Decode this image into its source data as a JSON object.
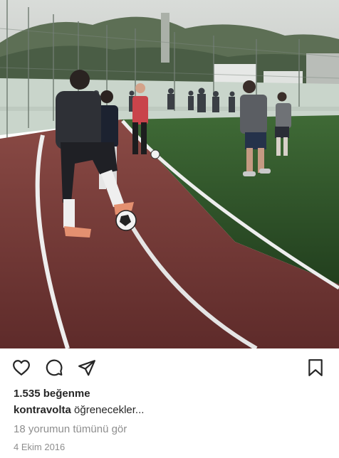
{
  "post": {
    "likes_text": "1.535 beğenme",
    "caption_user": "kontravolta",
    "caption_text": "öğrenecekler...",
    "comments_link": "18 yorumun tümünü gör",
    "date": "4 Ekim 2016"
  },
  "icons": {
    "like": "heart-icon",
    "comment": "comment-icon",
    "share": "paper-plane-icon",
    "save": "bookmark-icon"
  },
  "colors": {
    "text": "#262626",
    "secondary": "#8e8e8e",
    "track": "#7a3a38",
    "turf": "#2f5e2a"
  }
}
